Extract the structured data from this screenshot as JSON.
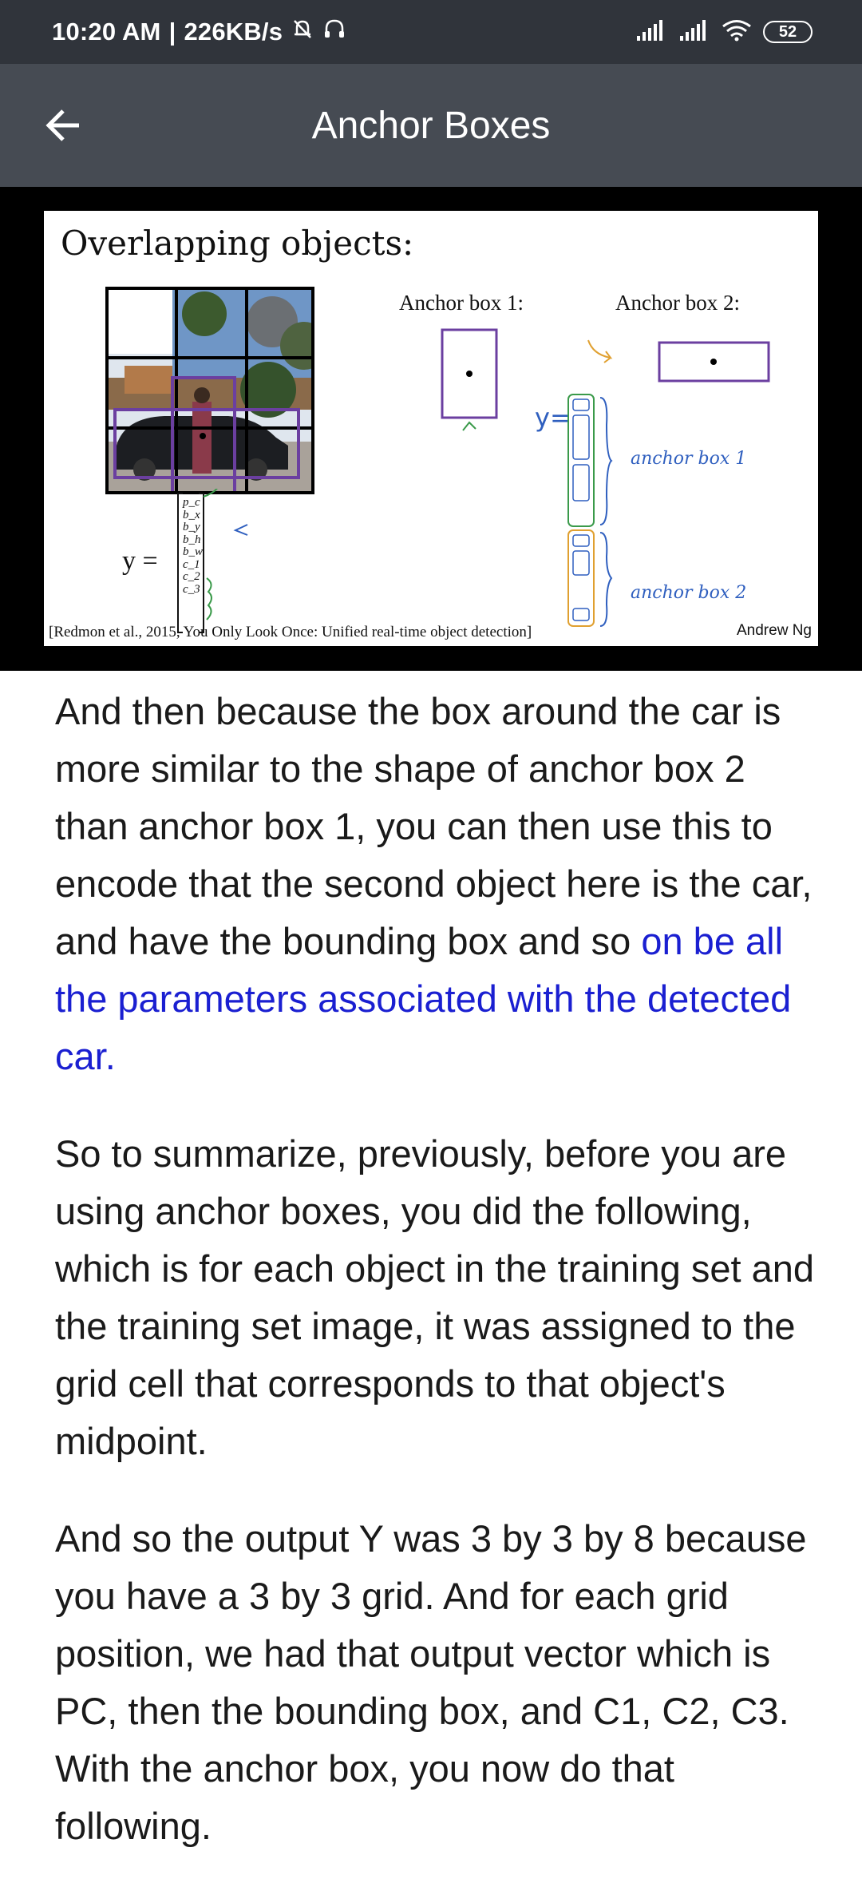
{
  "status_bar": {
    "time": "10:20 AM",
    "speed": "226KB/s",
    "battery": "52",
    "icons": [
      "alarm-off-icon",
      "headset-icon",
      "signal-icon",
      "signal-icon",
      "wifi-icon",
      "battery-icon"
    ]
  },
  "app_bar": {
    "title": "Anchor Boxes",
    "back_icon": "arrow-left-icon"
  },
  "slide": {
    "title": "Overlapping objects:",
    "anchor1_label": "Anchor box 1:",
    "anchor2_label": "Anchor box 2:",
    "y_label": "y  =",
    "vector": [
      "p_c",
      "b_x",
      "b_y",
      "b_h",
      "b_w",
      "c_1",
      "c_2",
      "c_3"
    ],
    "handwritten": {
      "y_eq": "y=",
      "anchor_box_1": "anchor box 1",
      "anchor_box_2": "anchor box 2"
    },
    "citation": "[Redmon et al., 2015, You Only Look Once: Unified real-time object detection]",
    "author": "Andrew Ng"
  },
  "transcript": {
    "p1_plain": "And then because the box around the car is more similar to the shape of anchor box 2 than anchor box 1, you can then use this to encode that the second object here is the car, and have the bounding box and so",
    "p1_highlight": "on be all the parameters associated with the detected car.",
    "p2": "So to summarize, previously, before you are using anchor boxes, you did the following, which is for each object in the training set and the training set image, it was assigned to the grid cell that corresponds to that object's midpoint.",
    "p3": "And so the output Y was 3 by 3 by 8 because you have a 3 by 3 grid. And for each grid position, we had that output vector which is PC, then the bounding box, and C1, C2, C3. With the anchor box, you now do that following."
  },
  "colors": {
    "status_bar": "#30343b",
    "app_bar": "#464b53",
    "highlight_text": "#1a1fd1",
    "box_purple": "#6b3fa0",
    "pen_green": "#3a9a4a",
    "pen_blue": "#2f5fbf",
    "pen_orange": "#e0a030"
  }
}
